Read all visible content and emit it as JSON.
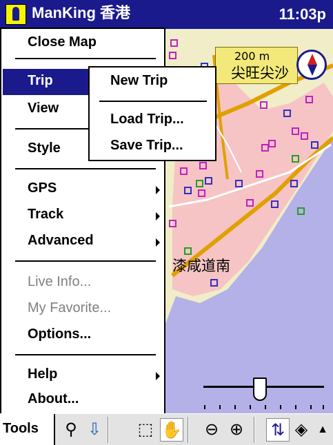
{
  "app": {
    "title": "ManKing 香港",
    "clock": "11:03p"
  },
  "map": {
    "scale_label": "200 m",
    "labels": [
      {
        "id": "map-label-tsim-sha-tsui",
        "text": "尖旺尖沙"
      },
      {
        "id": "map-label-nathan-road",
        "text": "漆咸道南"
      }
    ],
    "colors": {
      "land": "#f0edc8",
      "water": "#b4b1e8",
      "block": "#f6c4c4",
      "road": "#e0a000"
    }
  },
  "menu": {
    "items": [
      {
        "label": "Close Map"
      },
      {
        "label": "Trip",
        "selected": true
      },
      {
        "label": "View"
      },
      {
        "label": "Style"
      },
      {
        "label": "GPS",
        "submenu": true
      },
      {
        "label": "Track",
        "submenu": true
      },
      {
        "label": "Advanced",
        "submenu": true
      },
      {
        "label": "Live Info...",
        "disabled": true
      },
      {
        "label": "My Favorite...",
        "disabled": true
      },
      {
        "label": "Options..."
      },
      {
        "label": "Help",
        "submenu": true
      },
      {
        "label": "About..."
      }
    ]
  },
  "trip_menu": {
    "items": [
      {
        "label": "New Trip"
      },
      {
        "label": "Load Trip..."
      },
      {
        "label": "Save Trip..."
      }
    ]
  },
  "toolbar": {
    "tools_label": "Tools",
    "icons": [
      "binoculars-icon",
      "download-icon",
      "select-icon",
      "hand-icon",
      "zoom-out-icon",
      "zoom-in-icon",
      "sort-icon",
      "layers-icon",
      "scroll-up-icon"
    ]
  }
}
